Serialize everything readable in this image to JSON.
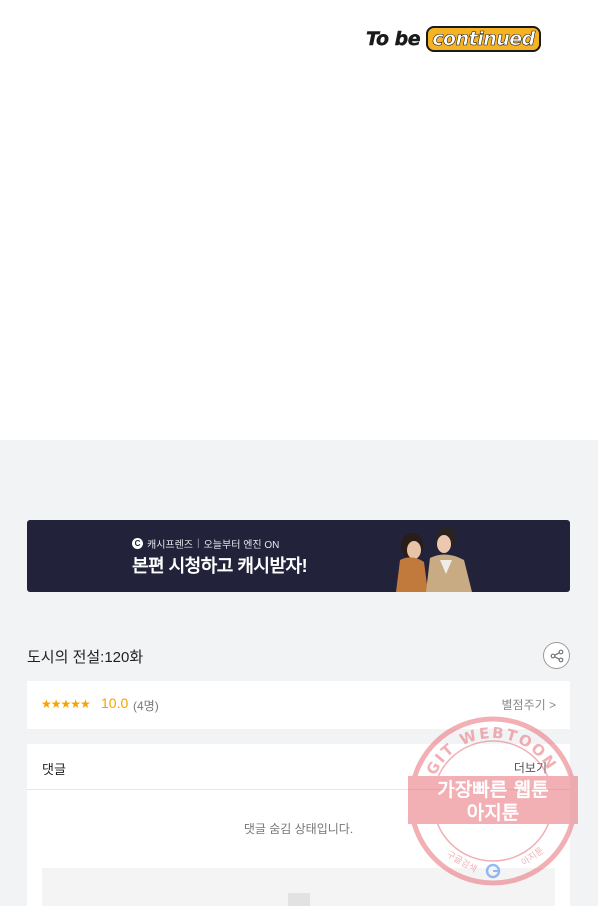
{
  "comic": {
    "end_text_part1": "To be",
    "end_text_part2": "continued"
  },
  "banner": {
    "logo_letter": "C",
    "brand": "캐시프렌즈",
    "divider": "|",
    "tagline": "오늘부터 엔진 ON",
    "headline": "본편 시청하고 캐시받자!"
  },
  "episode": {
    "title": "도시의 전설:120화"
  },
  "rating": {
    "stars": "★★★★★",
    "score": "10.0",
    "count": "(4명)",
    "rate_button": "별점주기 >"
  },
  "comments": {
    "title": "댓글",
    "more": "더보기",
    "hidden_notice": "댓글 숨김 상태입니다."
  },
  "watermark": {
    "arc_text": "AGIT WEBTOON",
    "line1": "가장빠른 웹툰",
    "line2": "아지툰",
    "bottom_left": "구글검색",
    "bottom_right": "아지툰"
  },
  "colors": {
    "banner_bg": "#22223a",
    "star": "#f5a300",
    "watermark": "#e8707a"
  }
}
